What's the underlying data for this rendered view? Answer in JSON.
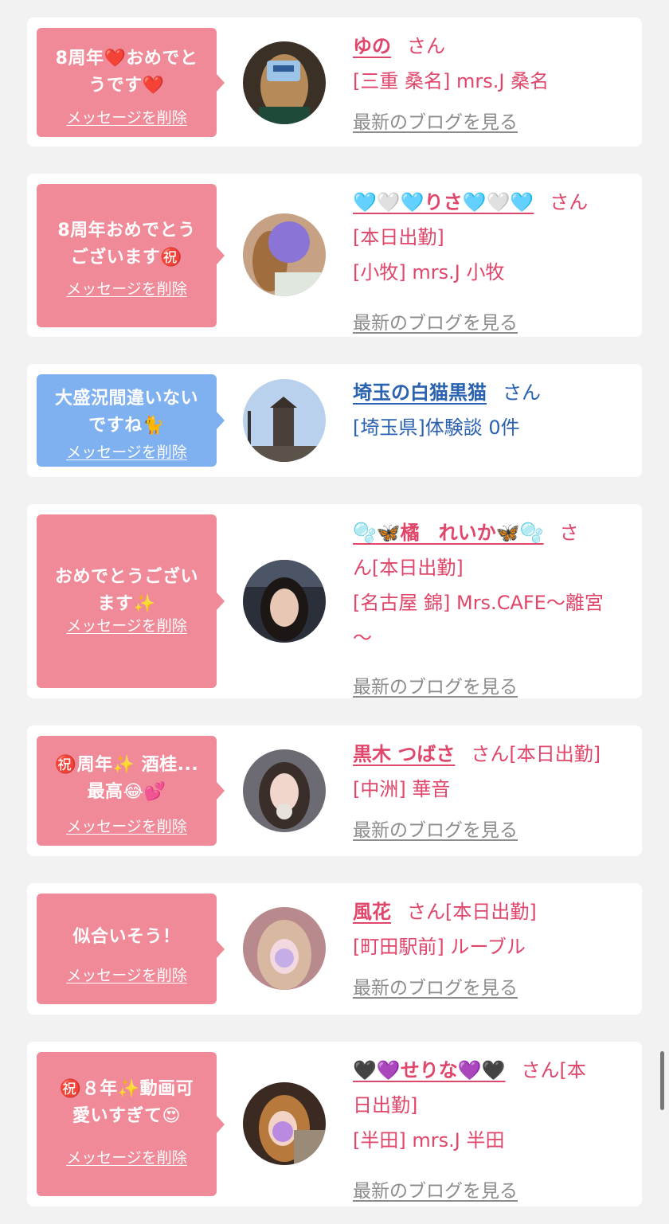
{
  "cards": [
    {
      "message_line1": "8周年❤️おめでと",
      "message_line2": "うです❤️",
      "delete_label": "メッセージを削除",
      "name": "ゆの",
      "suffix": "さん",
      "lines": [
        "[三重 桑名] mrs.J 桑名"
      ],
      "blog_label": "最新のブログを見る"
    },
    {
      "message_line1": "8周年おめでとう",
      "message_line2": "ございます㊗️",
      "delete_label": "メッセージを削除",
      "name": "🩵🤍🩵りさ🩵🤍🩵",
      "suffix": "さん",
      "lines": [
        "[本日出勤]",
        "[小牧] mrs.J 小牧"
      ],
      "blog_label": "最新のブログを見る"
    },
    {
      "message_line1": "大盛況間違いない",
      "message_line2": "ですね🐈",
      "delete_label": "メッセージを削除",
      "name": "埼玉の白猫黒猫",
      "suffix": "さん",
      "lines": [
        "[埼玉県]体験談 0件"
      ]
    },
    {
      "message_line1": "おめでとうござい",
      "message_line2": "ます✨",
      "delete_label": "メッセージを削除",
      "name": "🫧🦋橘　れいか🦋🫧",
      "suffix": "さ",
      "suffix2": "ん[本日出勤]",
      "lines": [
        "[名古屋 錦] Mrs.CAFE〜離宮",
        "〜"
      ],
      "blog_label": "最新のブログを見る"
    },
    {
      "message_line1": "㊗️周年✨ 酒桂...",
      "message_line2": "最高😂💕",
      "delete_label": "メッセージを削除",
      "name": "黒木 つばさ",
      "suffix": "さん[本日出勤]",
      "lines": [
        "[中洲] 華音"
      ],
      "blog_label": "最新のブログを見る"
    },
    {
      "message_line1": "似合いそう！",
      "message_line2": "",
      "delete_label": "メッセージを削除",
      "name": "風花",
      "suffix": "さん[本日出勤]",
      "lines": [
        "[町田駅前] ルーブル"
      ],
      "blog_label": "最新のブログを見る"
    },
    {
      "message_line1": "㊗️８年✨動画可",
      "message_line2": "愛いすぎて😍",
      "delete_label": "メッセージを削除",
      "name": "🖤💜せりな💜🖤",
      "suffix": "さん[本",
      "suffix2": "日出勤]",
      "lines": [
        "[半田] mrs.J 半田"
      ],
      "blog_label": "最新のブログを見る"
    }
  ],
  "colors": {
    "background": "#f2f2f2",
    "card": "#ffffff",
    "bubble_pink": "#f08a98",
    "bubble_blue": "#7fb0f0",
    "text_pink": "#e0456a",
    "text_blue": "#2a62b0",
    "blog_gray": "#8c8c8c"
  }
}
